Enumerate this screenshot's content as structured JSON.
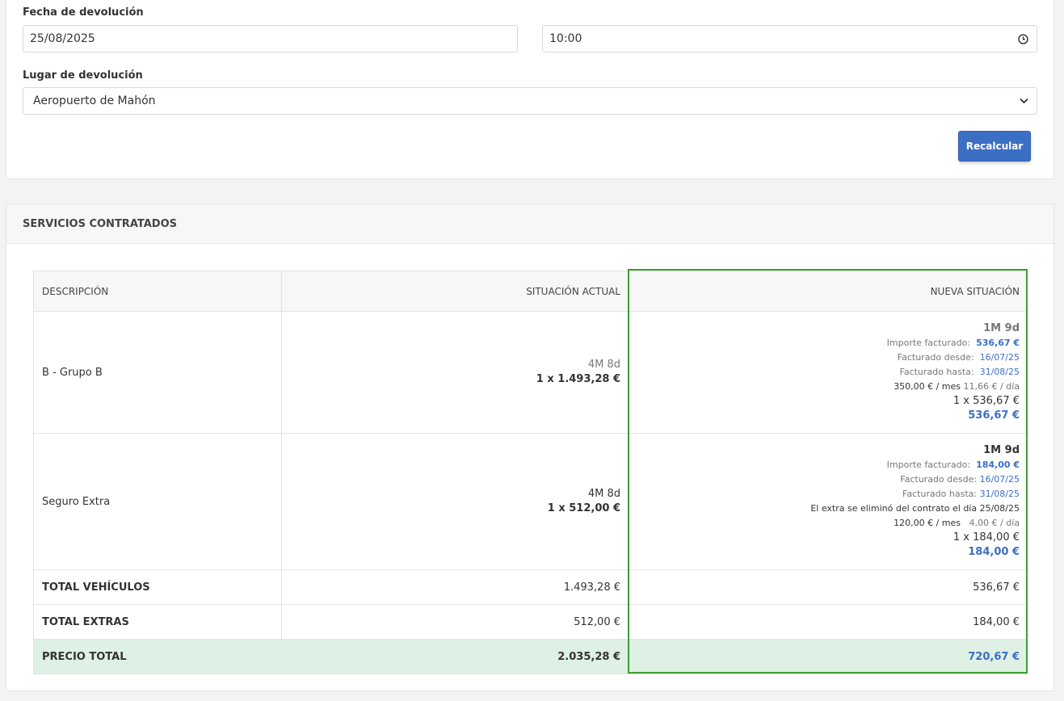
{
  "return_form": {
    "date_label": "Fecha de devolución",
    "date_value": "25/08/2025",
    "time_value": "10:00",
    "place_label": "Lugar de devolución",
    "place_value": "Aeropuerto de Mahón",
    "recalc_label": "Recalcular"
  },
  "services": {
    "title": "SERVICIOS CONTRATADOS",
    "headers": {
      "desc": "DESCRIPCIÓN",
      "current": "SITUACIÓN ACTUAL",
      "new": "NUEVA SITUACIÓN"
    },
    "rows": [
      {
        "desc": "B - Grupo B",
        "current_duration": "4M 8d",
        "current_amount": "1 x 1.493,28 €",
        "new_duration": "1M 9d",
        "billed_label": "Importe facturado:",
        "billed_value": "536,67 €",
        "from_label": "Facturado desde:",
        "from_value": "16/07/25",
        "to_label": "Facturado hasta:",
        "to_value": "31/08/25",
        "rate_month": "350,00 € / mes",
        "rate_day": "11,66 € / día",
        "new_qty": "1 x 536,67 €",
        "new_total": "536,67 €"
      },
      {
        "desc": "Seguro Extra",
        "current_duration": "4M 8d",
        "current_amount": "1 x 512,00 €",
        "new_duration": "1M 9d",
        "billed_label": "Importe facturado:",
        "billed_value": "184,00 €",
        "from_label": "Facturado desde:",
        "from_value": "16/07/25",
        "to_label": "Facturado hasta:",
        "to_value": "31/08/25",
        "note": "El extra se eliminó del contrato el día 25/08/25",
        "rate_month": "120,00 € / mes",
        "rate_day": "4,00 € / día",
        "new_qty": "1 x 184,00 €",
        "new_total": "184,00 €"
      }
    ],
    "totals": [
      {
        "label": "TOTAL VEHÍCULOS",
        "current": "1.493,28 €",
        "new": "536,67 €"
      },
      {
        "label": "TOTAL EXTRAS",
        "current": "512,00 €",
        "new": "184,00 €"
      },
      {
        "label": "PRECIO TOTAL",
        "current": "2.035,28 €",
        "new": "720,67 €"
      }
    ]
  },
  "colors": {
    "accent": "#3b6fc4",
    "highlight_border": "#3aa02f",
    "total_bg": "#dff0e5"
  },
  "icons": {
    "time": "clock-icon",
    "select": "chevron-down-icon"
  }
}
